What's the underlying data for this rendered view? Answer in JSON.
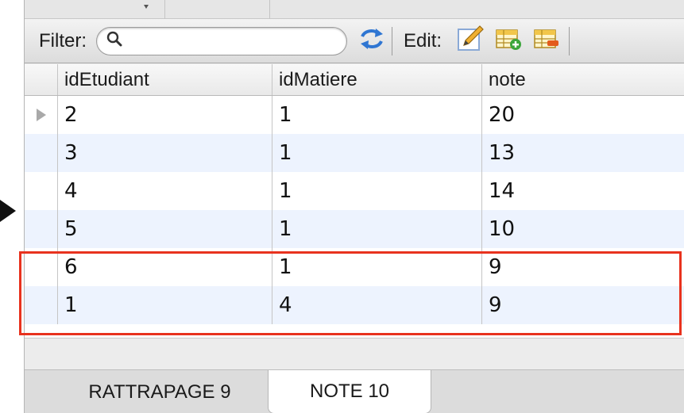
{
  "toolbar": {
    "filter_label": "Filter:",
    "search_placeholder": "",
    "search_value": "",
    "edit_label": "Edit:",
    "icons": [
      "search-icon",
      "refresh-icon",
      "edit-pencil-icon",
      "add-row-icon",
      "delete-row-icon"
    ]
  },
  "table": {
    "columns": [
      "idEtudiant",
      "idMatiere",
      "note"
    ],
    "rows": [
      [
        "2",
        "1",
        "20"
      ],
      [
        "3",
        "1",
        "13"
      ],
      [
        "4",
        "1",
        "14"
      ],
      [
        "5",
        "1",
        "10"
      ],
      [
        "6",
        "1",
        "9"
      ],
      [
        "1",
        "4",
        "9"
      ]
    ],
    "highlighted_rows": [
      4,
      5
    ],
    "highlight_color": "#e8321e",
    "alt_row_color": "#edf3fe"
  },
  "tabs": [
    {
      "label": "RATTRAPAGE 9",
      "active": false
    },
    {
      "label": "NOTE 10",
      "active": true
    }
  ]
}
